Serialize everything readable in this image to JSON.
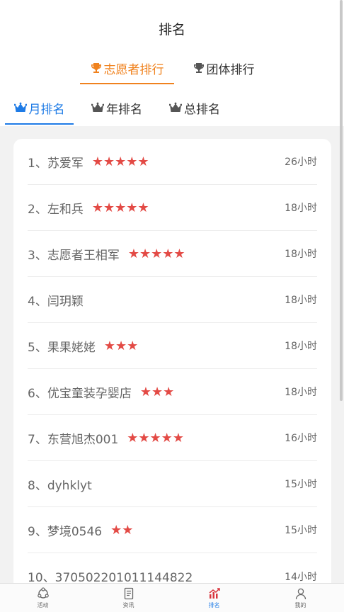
{
  "header": {
    "title": "排名"
  },
  "type_tabs": [
    {
      "label": "志愿者排行",
      "icon": "trophy-icon",
      "active": true
    },
    {
      "label": "团体排行",
      "icon": "trophy-icon",
      "active": false
    }
  ],
  "period_tabs": [
    {
      "label": "月排名",
      "icon": "crown-icon",
      "active": true
    },
    {
      "label": "年排名",
      "icon": "crown-icon",
      "active": false
    },
    {
      "label": "总排名",
      "icon": "crown-icon",
      "active": false
    }
  ],
  "rankings": [
    {
      "name": "1、苏爱军",
      "stars": "★★★★★",
      "star_count": 5,
      "hours": "26小时"
    },
    {
      "name": "2、左和兵",
      "stars": "★★★★★",
      "star_count": 5,
      "hours": "18小时"
    },
    {
      "name": "3、志愿者王相军",
      "stars": "★★★★★",
      "star_count": 5,
      "hours": "18小时"
    },
    {
      "name": "4、闫玥颖",
      "stars": "",
      "star_count": 0,
      "hours": "18小时"
    },
    {
      "name": "5、果果姥姥",
      "stars": "★★★",
      "star_count": 3,
      "hours": "18小时"
    },
    {
      "name": "6、优宝童装孕婴店",
      "stars": "★★★",
      "star_count": 3,
      "hours": "18小时"
    },
    {
      "name": "7、东营旭杰001",
      "stars": "★★★★★",
      "star_count": 5,
      "hours": "16小时"
    },
    {
      "name": "8、dyhklyt",
      "stars": "",
      "star_count": 0,
      "hours": "15小时"
    },
    {
      "name": "9、梦境0546",
      "stars": "★★",
      "star_count": 2,
      "hours": "15小时"
    },
    {
      "name": "10、370502201011144822",
      "stars": "",
      "star_count": 0,
      "hours": "14小时"
    }
  ],
  "bottom_nav": [
    {
      "label": "活动",
      "icon": "activity-icon",
      "active": false
    },
    {
      "label": "资讯",
      "icon": "news-icon",
      "active": false
    },
    {
      "label": "排名",
      "icon": "ranking-chart-icon",
      "active": true
    },
    {
      "label": "我的",
      "icon": "profile-icon",
      "active": false
    }
  ],
  "colors": {
    "accent_orange": "#f0821e",
    "accent_blue": "#1e7be6",
    "star_red": "#e34a45",
    "background": "#f2f2f2"
  }
}
